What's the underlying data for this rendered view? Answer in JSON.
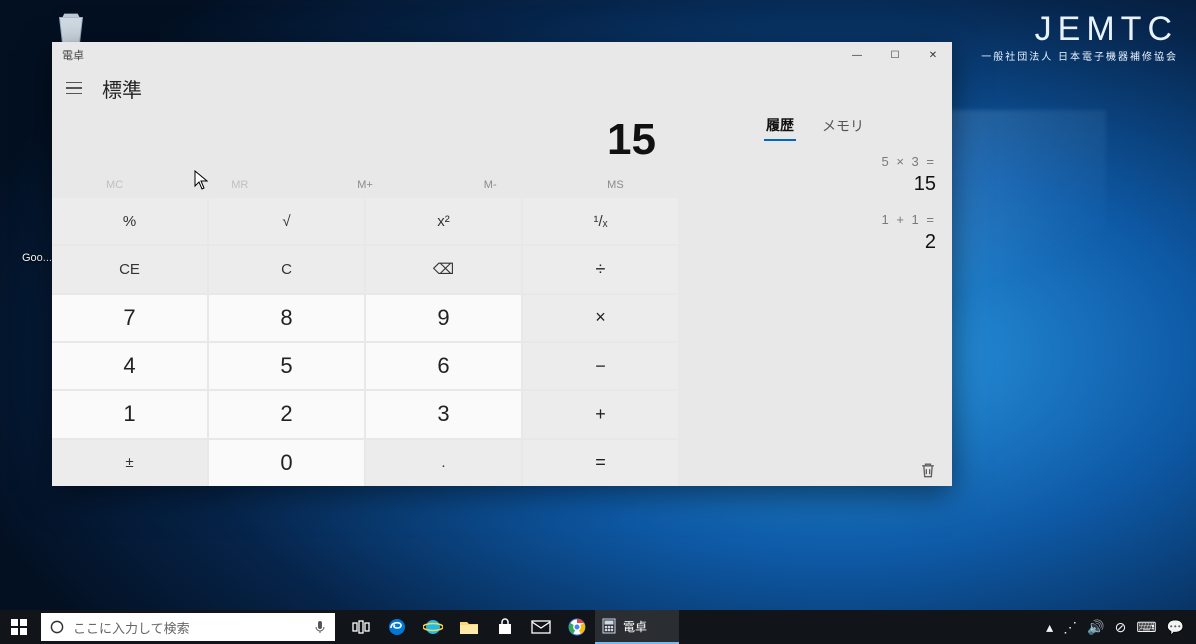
{
  "watermark": {
    "title": "JEMTC",
    "subtitle": "一般社団法人 日本電子機器補修協会"
  },
  "desktop": {
    "goo_label": "Goo..."
  },
  "window": {
    "title": "電卓",
    "minimize": "—",
    "maximize": "☐",
    "close": "✕"
  },
  "calculator": {
    "mode_label": "標準",
    "display": "15",
    "memory_buttons": [
      "MC",
      "MR",
      "M+",
      "M-",
      "MS"
    ],
    "functions_row1": [
      "%",
      "√",
      "x²",
      "¹/ₓ"
    ],
    "functions_row2": [
      "CE",
      "C",
      "⌫",
      "÷"
    ],
    "row3": [
      "7",
      "8",
      "9",
      "×"
    ],
    "row4": [
      "4",
      "5",
      "6",
      "−"
    ],
    "row5": [
      "1",
      "2",
      "3",
      "+"
    ],
    "row6": [
      "±",
      "0",
      ".",
      "="
    ],
    "tabs": {
      "history": "履歴",
      "memory": "メモリ"
    },
    "history": [
      {
        "expr": "5 × 3 =",
        "result": "15"
      },
      {
        "expr": "1 + 1 =",
        "result": "2"
      }
    ]
  },
  "taskbar": {
    "search_placeholder": "ここに入力して検索",
    "running_app_label": "電卓",
    "tray": {
      "up": "▴",
      "wifi": "⋰",
      "sound": "🔊",
      "help": "⊘",
      "ime": "⌨",
      "notify": "💬"
    }
  }
}
